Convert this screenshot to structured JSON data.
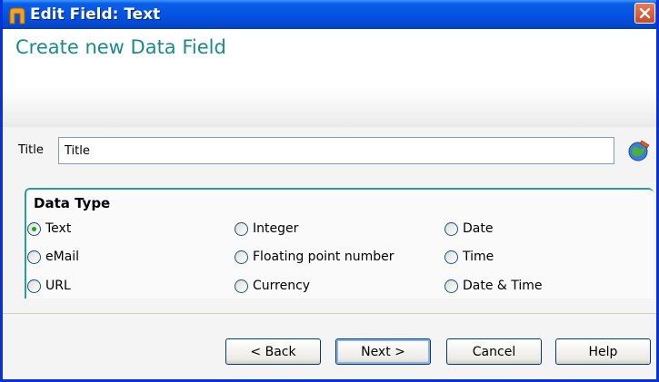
{
  "window": {
    "title": "Edit Field: Text"
  },
  "header": {
    "title": "Create new Data Field"
  },
  "title_field": {
    "label": "Title",
    "value": "Title"
  },
  "data_type": {
    "legend": "Data Type",
    "options": [
      {
        "label": "Text",
        "checked": true
      },
      {
        "label": "eMail",
        "checked": false
      },
      {
        "label": "URL",
        "checked": false
      },
      {
        "label": "Integer",
        "checked": false
      },
      {
        "label": "Floating point number",
        "checked": false
      },
      {
        "label": "Currency",
        "checked": false
      },
      {
        "label": "Date",
        "checked": false
      },
      {
        "label": "Time",
        "checked": false
      },
      {
        "label": "Date & Time",
        "checked": false
      }
    ]
  },
  "buttons": {
    "back": "< Back",
    "next": "Next >",
    "cancel": "Cancel",
    "help": "Help"
  },
  "colors": {
    "accent": "#1b8a8e",
    "titlebar": "#0554e3",
    "radio_checked": "#21a121"
  },
  "icons": {
    "app": "app-icon",
    "close": "close-icon",
    "globe": "globe-icon"
  }
}
